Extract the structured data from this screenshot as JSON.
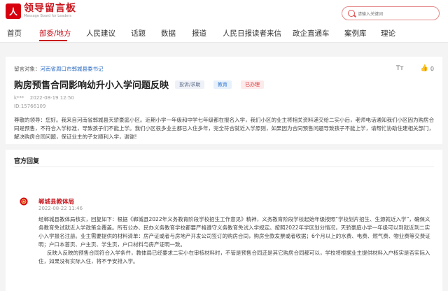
{
  "logo": {
    "mark": "人",
    "title": "领导留言板",
    "subtitle": "Message Board for Leaders"
  },
  "search": {
    "placeholder": "请输入关键词"
  },
  "nav": [
    "首页",
    "部委/地方",
    "人民建议",
    "话题",
    "数据",
    "报道",
    "人民日报读者来信",
    "政企直通车",
    "案例库",
    "理论"
  ],
  "post": {
    "target_label": "留言对象：",
    "target": "河南省周口市郸城县委书记",
    "title": "购房预售合同影响幼升小入学问题反映",
    "tags": [
      "投诉/求助",
      "教育",
      "已办理"
    ],
    "tt": "Tт",
    "likes": "0",
    "author": "k***",
    "date": "2022-08-19 12:50",
    "id": "ID:15766109",
    "content": "尊敬的领导：您好。我来自河南省郸城县天骄豪庭小区。近期小学一年级和中学七年级都在报名入学，我们小区的业主将相关资料递交给二实小后，老师电话通知我们小区因为购房合同是预售，不符合入学标准，导致孩子们不能上学。我们小区很多业主都已入住多年，完全符合就近入学原则，如果因为合同预售问题导致孩子不能上学，请帮忙协助住建相关部门，解决购房合同问题，保证业主的子女顺利入学，谢谢!"
  },
  "reply": {
    "section_title": "官方回复",
    "org": "郸城县教体局",
    "date": "2022-08-22 11:46",
    "para1": "经郸城县教体局核实，回复如下：根据《郸城县2022年义务教育阶段学校招生工作意见》精神，义务教育阶段学校起始年级按照“学校划片招生、生源就近入学”，确保义务教育免试就近入学政策全覆盖。所有公办、民办义务教育学校都要严格遵守义务教育免试入学规定。按照2022年学区划分情况，天骄豪庭小学一年级可以到就近到二实小入学报名注册。业主需要提供的材料清单：房产证或者与房地产开发公司签订的购房合同，购房全款发票或者收据；6个月以上的水费、电费、燃气费、物业费等交费证明；户口本首页、户主页、学生页，户口材料与房产证明一致。",
    "para2": "反映人反映的预售合同符合入学条件，教体局已经要求二实小在审核材料时，不管是预售合同还是其它购房合同都可以，学校将根据业主提供材料入户核实是否实际入住，如果没有实际入住，将不予安排入学。"
  },
  "colors": {
    "brand": "#c8151d",
    "link": "#2b6bc0"
  }
}
